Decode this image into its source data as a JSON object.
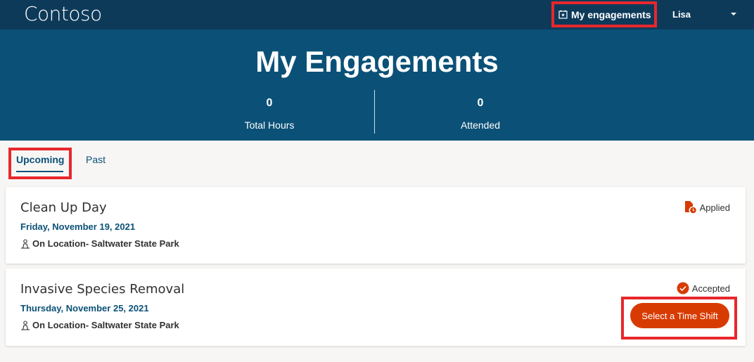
{
  "header": {
    "brand": "Contoso",
    "nav_engagements": "My engagements",
    "user_name": "Lisa"
  },
  "hero": {
    "title": "My Engagements",
    "stats": [
      {
        "value": "0",
        "label": "Total Hours"
      },
      {
        "value": "0",
        "label": "Attended"
      }
    ]
  },
  "tabs": [
    {
      "label": "Upcoming",
      "active": true
    },
    {
      "label": "Past",
      "active": false
    }
  ],
  "engagements": [
    {
      "title": "Clean Up Day",
      "date": "Friday, November 19, 2021",
      "location": "On Location- Saltwater State Park",
      "status": "Applied",
      "status_icon": "document-clock-icon"
    },
    {
      "title": "Invasive Species Removal",
      "date": "Thursday, November 25, 2021",
      "location": "On Location- Saltwater State Park",
      "status": "Accepted",
      "status_icon": "check-circle-icon",
      "action_label": "Select a Time Shift"
    }
  ],
  "colors": {
    "topbar": "#0e3a5a",
    "hero": "#0b5177",
    "accent": "#d83b01",
    "highlight": "#e8272c"
  }
}
